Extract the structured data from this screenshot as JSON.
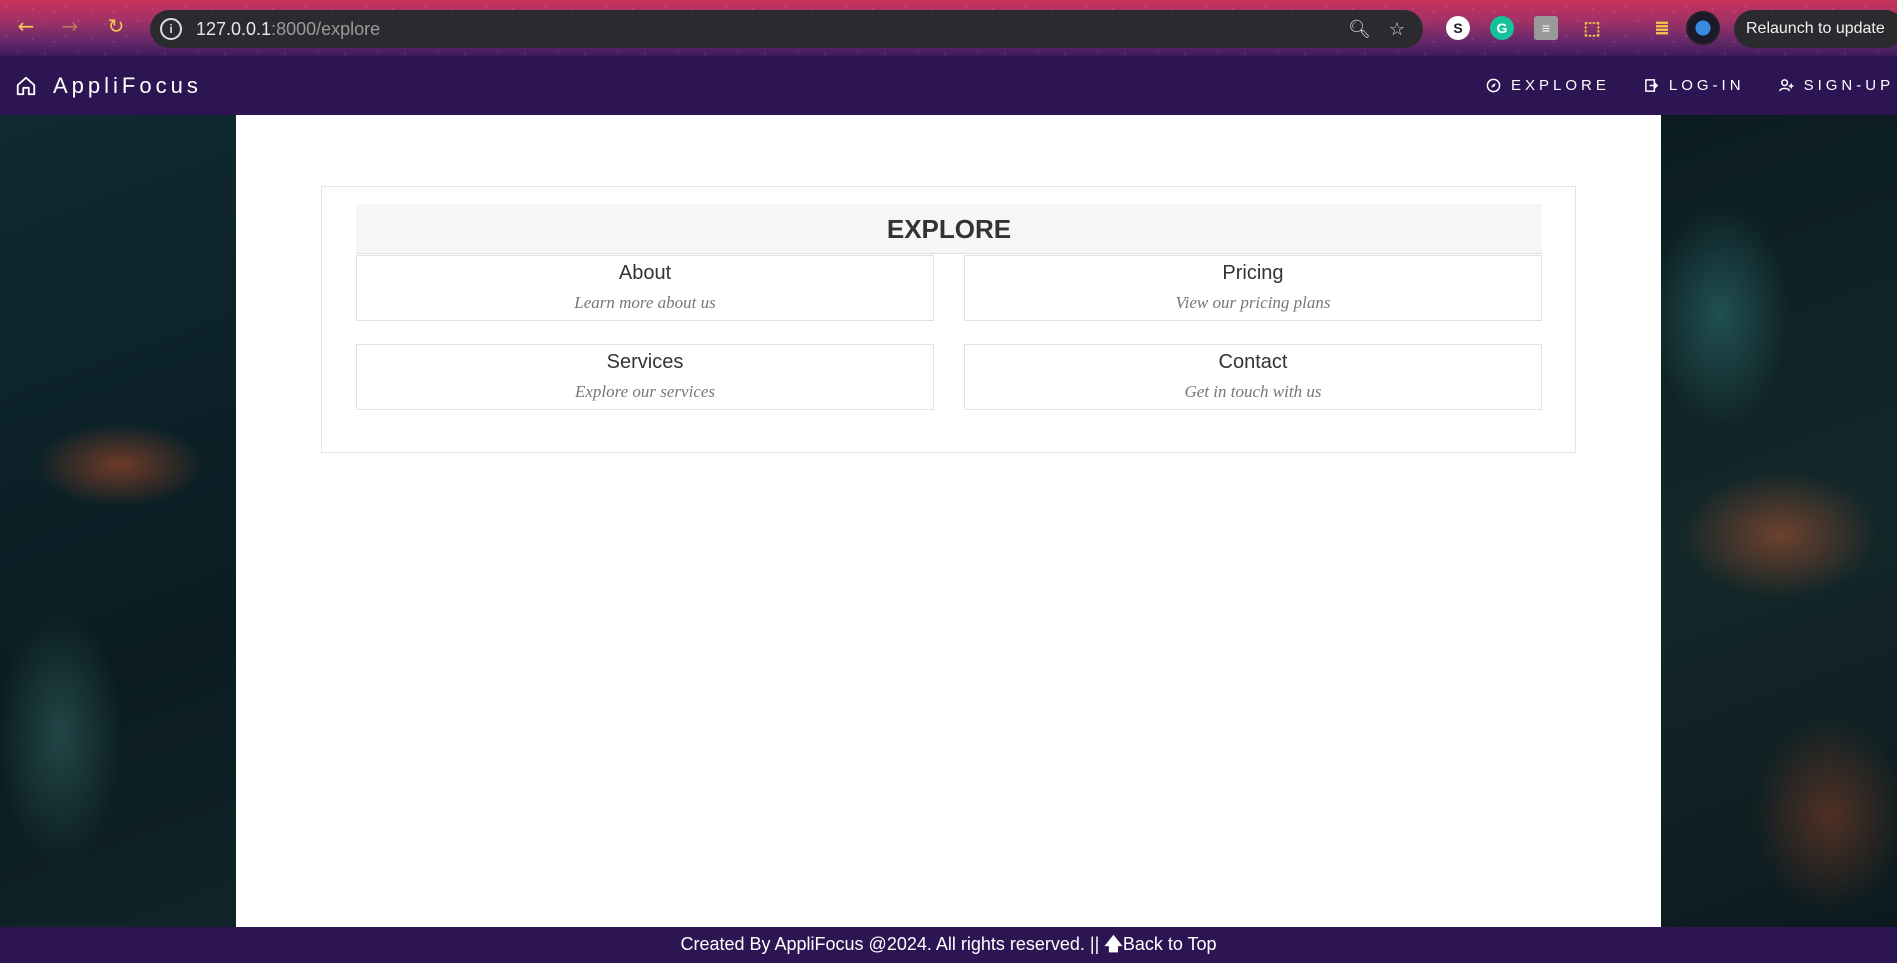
{
  "browser": {
    "url_host": "127.0.0.1",
    "url_rest": ":8000/explore",
    "relaunch_label": "Relaunch to update"
  },
  "navbar": {
    "brand": "AppliFocus",
    "links": [
      {
        "label": "EXPLORE",
        "icon": "compass-icon"
      },
      {
        "label": "LOG-IN",
        "icon": "login-icon"
      },
      {
        "label": "SIGN-UP",
        "icon": "user-plus-icon"
      }
    ]
  },
  "explore": {
    "title": "EXPLORE",
    "cards": [
      {
        "title": "About",
        "subtitle": "Learn more about us"
      },
      {
        "title": "Pricing",
        "subtitle": "View our pricing plans"
      },
      {
        "title": "Services",
        "subtitle": "Explore our services"
      },
      {
        "title": "Contact",
        "subtitle": "Get in touch with us"
      }
    ]
  },
  "footer": {
    "text": "Created By AppliFocus @2024. All rights reserved. ||",
    "back_to_top": "Back to Top"
  },
  "colors": {
    "nav_bg": "#2d1553",
    "panel_header_bg": "#f6f6f6"
  }
}
